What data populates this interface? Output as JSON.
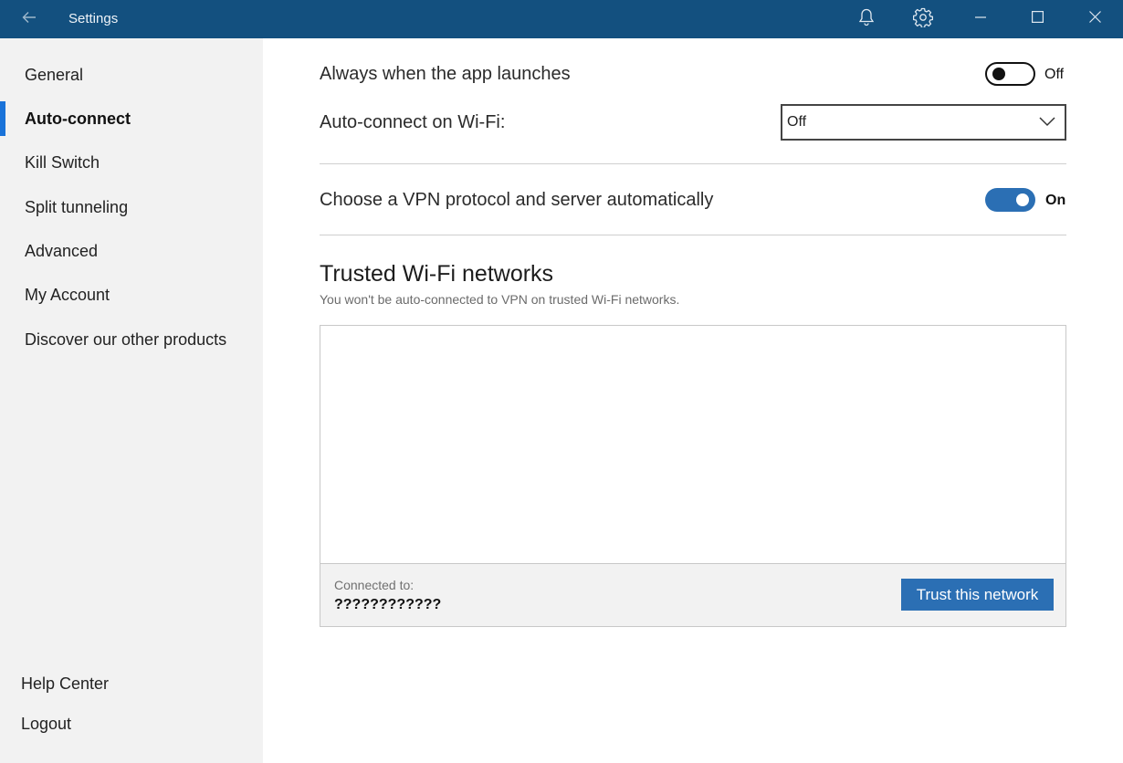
{
  "window": {
    "title": "Settings"
  },
  "sidebar": {
    "items": [
      {
        "label": "General"
      },
      {
        "label": "Auto-connect"
      },
      {
        "label": "Kill Switch"
      },
      {
        "label": "Split tunneling"
      },
      {
        "label": "Advanced"
      },
      {
        "label": "My Account"
      },
      {
        "label": "Discover our other products"
      }
    ],
    "active_item": "Auto-connect",
    "bottom_items": [
      {
        "label": "Help Center"
      },
      {
        "label": "Logout"
      }
    ]
  },
  "main": {
    "app_launch": {
      "label": "Always when the app launches",
      "state_text": "Off",
      "enabled": false
    },
    "wifi": {
      "label": "Auto-connect on Wi-Fi:",
      "selected": "Off"
    },
    "auto_protocol": {
      "label": "Choose a VPN protocol and server automatically",
      "state_text": "On",
      "enabled": true
    },
    "trusted": {
      "title": "Trusted Wi-Fi networks",
      "subtitle": "You won't be auto-connected to VPN on trusted Wi-Fi networks.",
      "connected_label": "Connected to:",
      "connected_network": "????????????",
      "trust_button": "Trust this network"
    }
  },
  "colors": {
    "titlebar": "#13507f",
    "accent": "#2b6fb4",
    "active_indicator": "#1a73d9",
    "sidebar_bg": "#f2f2f2"
  },
  "icons": {
    "back": "arrow-left-icon",
    "notifications": "bell-icon",
    "settings": "gear-icon",
    "minimize": "minimize-icon",
    "maximize": "maximize-icon",
    "close": "close-icon",
    "dropdown": "chevron-down-icon"
  }
}
